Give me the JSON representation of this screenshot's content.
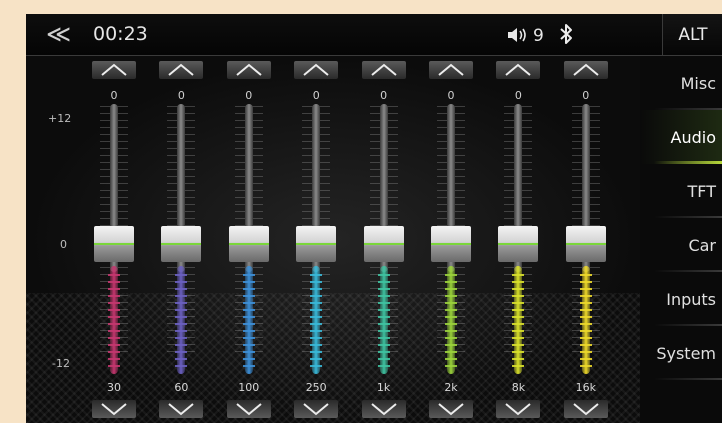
{
  "topbar": {
    "back_icon": "double-chevron-left-icon",
    "time": "00:23",
    "volume_icon": "speaker-icon",
    "volume": "9",
    "bluetooth_icon": "bluetooth-icon",
    "alt_label": "ALT"
  },
  "scale": {
    "top": "+12",
    "mid": "0",
    "bottom": "-12"
  },
  "bands": [
    {
      "freq": "30",
      "gain": "0",
      "color": "#c4366e"
    },
    {
      "freq": "60",
      "gain": "0",
      "color": "#6a5fc0"
    },
    {
      "freq": "100",
      "gain": "0",
      "color": "#3c8fd8"
    },
    {
      "freq": "250",
      "gain": "0",
      "color": "#38b8d8"
    },
    {
      "freq": "1k",
      "gain": "0",
      "color": "#3ec2a0"
    },
    {
      "freq": "2k",
      "gain": "0",
      "color": "#9ad23a"
    },
    {
      "freq": "8k",
      "gain": "0",
      "color": "#d8e02a"
    },
    {
      "freq": "16k",
      "gain": "0",
      "color": "#ecd82a"
    }
  ],
  "menu": {
    "items": [
      {
        "label": "Misc",
        "active": false
      },
      {
        "label": "Audio",
        "active": true
      },
      {
        "label": "TFT",
        "active": false
      },
      {
        "label": "Car",
        "active": false
      },
      {
        "label": "Inputs",
        "active": false
      },
      {
        "label": "System",
        "active": false
      }
    ]
  },
  "colors": {
    "accent": "#b7d83a",
    "knob_indicator": "#7ad63a"
  }
}
